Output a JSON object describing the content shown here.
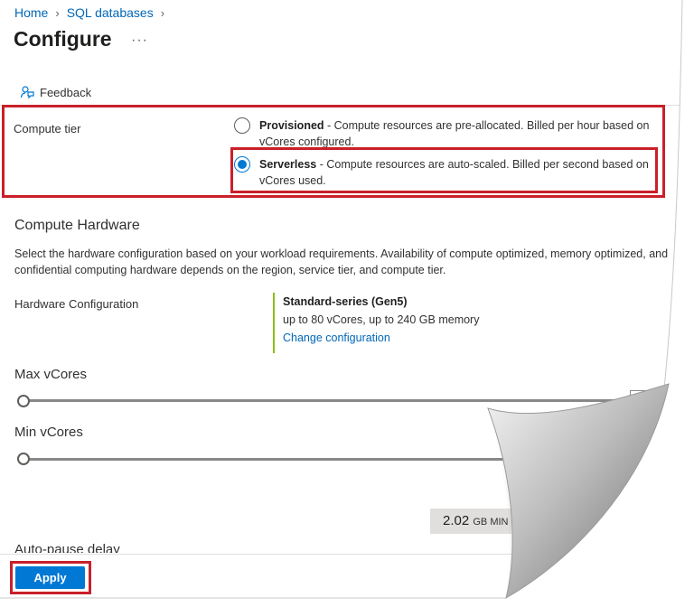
{
  "breadcrumb": {
    "items": [
      "Home",
      "SQL databases"
    ]
  },
  "page": {
    "title": "Configure",
    "more": "···"
  },
  "toolbar": {
    "feedback": "Feedback"
  },
  "compute_tier": {
    "label": "Compute tier",
    "options": [
      {
        "name": "Provisioned",
        "description": " - Compute resources are pre-allocated. Billed per hour based on",
        "description2": "vCores configured.",
        "selected": false
      },
      {
        "name": "Serverless",
        "description": " - Compute resources are auto-scaled. Billed per second based on",
        "description2": "vCores used.",
        "selected": true
      }
    ]
  },
  "hardware": {
    "title": "Compute Hardware",
    "description": "Select the hardware configuration based on your workload requirements. Availability of compute optimized, memory optimized, and confidential computing hardware depends on the region, service tier, and compute tier.",
    "config_label": "Hardware Configuration",
    "series": "Standard-series (Gen5)",
    "limits": "up to 80 vCores, up to 240 GB memory",
    "change_link": "Change configuration"
  },
  "max_vcores": {
    "label": "Max vCores"
  },
  "min_vcores": {
    "label": "Min vCores"
  },
  "memory": {
    "value": "2.02",
    "unit": "GB MIN"
  },
  "auto_pause": {
    "label": "Auto-pause delay"
  },
  "footer": {
    "apply": "Apply"
  },
  "colors": {
    "accent": "#0078d4",
    "link": "#0067b8",
    "highlight": "#c9202a",
    "hardware_bar": "#8cbd18"
  }
}
